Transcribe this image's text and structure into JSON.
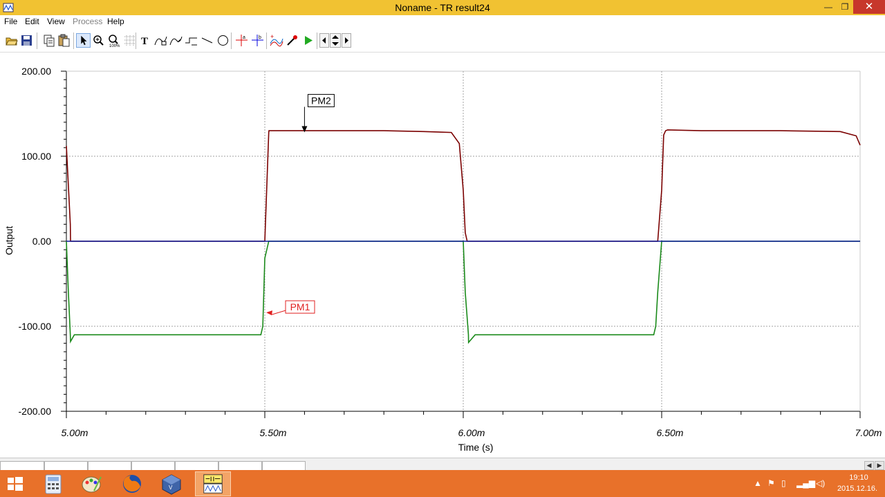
{
  "window": {
    "title": "Noname - TR result24",
    "controls": {
      "minimize": "—",
      "maximize": "❐",
      "close": "✕"
    }
  },
  "menu": [
    {
      "label": "File",
      "enabled": true
    },
    {
      "label": "Edit",
      "enabled": true
    },
    {
      "label": "View",
      "enabled": true
    },
    {
      "label": "Process",
      "enabled": false
    },
    {
      "label": "Help",
      "enabled": true
    }
  ],
  "toolbar": {
    "buttons": [
      {
        "name": "open-icon"
      },
      {
        "name": "save-icon"
      },
      {
        "name": "copy-icon"
      },
      {
        "name": "paste-icon"
      },
      {
        "name": "pointer-icon",
        "selected": true
      },
      {
        "name": "zoom-in-icon"
      },
      {
        "name": "zoom-100-icon"
      },
      {
        "name": "grid-icon"
      },
      {
        "name": "text-icon"
      },
      {
        "name": "curve-annotate-icon"
      },
      {
        "name": "curve-arrow-icon"
      },
      {
        "name": "step-icon"
      },
      {
        "name": "line-icon"
      },
      {
        "name": "ellipse-icon"
      },
      {
        "name": "cursor-a-icon"
      },
      {
        "name": "cursor-b-icon"
      },
      {
        "name": "add-curve-icon"
      },
      {
        "name": "probe-icon"
      },
      {
        "name": "run-icon"
      },
      {
        "name": "scroll-left-icon"
      },
      {
        "name": "scroll-vertical-icon"
      },
      {
        "name": "scroll-right-icon"
      }
    ]
  },
  "chart_data": {
    "type": "line",
    "title": "",
    "xlabel": "Time (s)",
    "ylabel": "Output",
    "xlim": [
      0.005,
      0.007
    ],
    "ylim": [
      -200,
      200
    ],
    "x_ticks": [
      "5.00m",
      "5.50m",
      "6.00m",
      "6.50m",
      "7.00m"
    ],
    "y_ticks": [
      "200.00",
      "100.00",
      "0.00",
      "-100.00",
      "-200.00"
    ],
    "grid": "dashed at major ticks",
    "series": [
      {
        "name": "PM2",
        "color": "#7b0000",
        "x": [
          0.005,
          0.00501,
          0.0050105,
          0.00509,
          0.0055,
          0.00551,
          0.0055105,
          0.0056,
          0.0058,
          0.0059,
          0.00597,
          0.00599,
          0.006,
          0.006005,
          0.00601,
          0.006015,
          0.0061,
          0.0064,
          0.00649,
          0.0065,
          0.006505,
          0.00651,
          0.006515,
          0.0066,
          0.0068,
          0.00695,
          0.00699,
          0.007
        ],
        "y": [
          112,
          20,
          0,
          0,
          0,
          128,
          130,
          130,
          130,
          129,
          128,
          115,
          60,
          10,
          0,
          0,
          0,
          0,
          0,
          60,
          125,
          130,
          131,
          130,
          130,
          129,
          124,
          113
        ]
      },
      {
        "name": "PM1",
        "color": "#1a8a1a",
        "x": [
          0.005,
          0.005005,
          0.00501,
          0.0050105,
          0.00502,
          0.0054,
          0.00549,
          0.005495,
          0.0055,
          0.00551,
          0.0058,
          0.006,
          0.006005,
          0.006013,
          0.0060135,
          0.00603,
          0.0064,
          0.00648,
          0.006485,
          0.00649,
          0.0065,
          0.0067,
          0.007
        ],
        "y": [
          0,
          -60,
          -110,
          -118,
          -110,
          -110,
          -110,
          -100,
          -20,
          0,
          0,
          0,
          -60,
          -110,
          -119,
          -110,
          -110,
          -110,
          -100,
          -60,
          0,
          0,
          0
        ]
      },
      {
        "name": "",
        "color": "#0b1a9a",
        "x": [
          0.005,
          0.0055,
          0.006,
          0.0065,
          0.007
        ],
        "y": [
          0,
          0,
          0,
          0,
          0
        ]
      }
    ],
    "annotations": [
      {
        "text": "PM2",
        "color": "#000000",
        "x": 0.0056,
        "y": 128
      },
      {
        "text": "PM1",
        "color": "#e02020",
        "x": 0.0055,
        "y": -83
      }
    ]
  },
  "taskbar": {
    "apps": [
      {
        "name": "windows-start-icon",
        "glyph": "⊞"
      },
      {
        "name": "calculator-icon",
        "glyph": "▦"
      },
      {
        "name": "paint-icon",
        "glyph": "✎"
      },
      {
        "name": "firefox-icon",
        "glyph": "●"
      },
      {
        "name": "virtualbox-icon",
        "glyph": "◈"
      },
      {
        "name": "circuit-sim-icon",
        "glyph": "⌁",
        "active": true
      }
    ],
    "clock_time": "19:10",
    "clock_date": "2015.12.16."
  }
}
